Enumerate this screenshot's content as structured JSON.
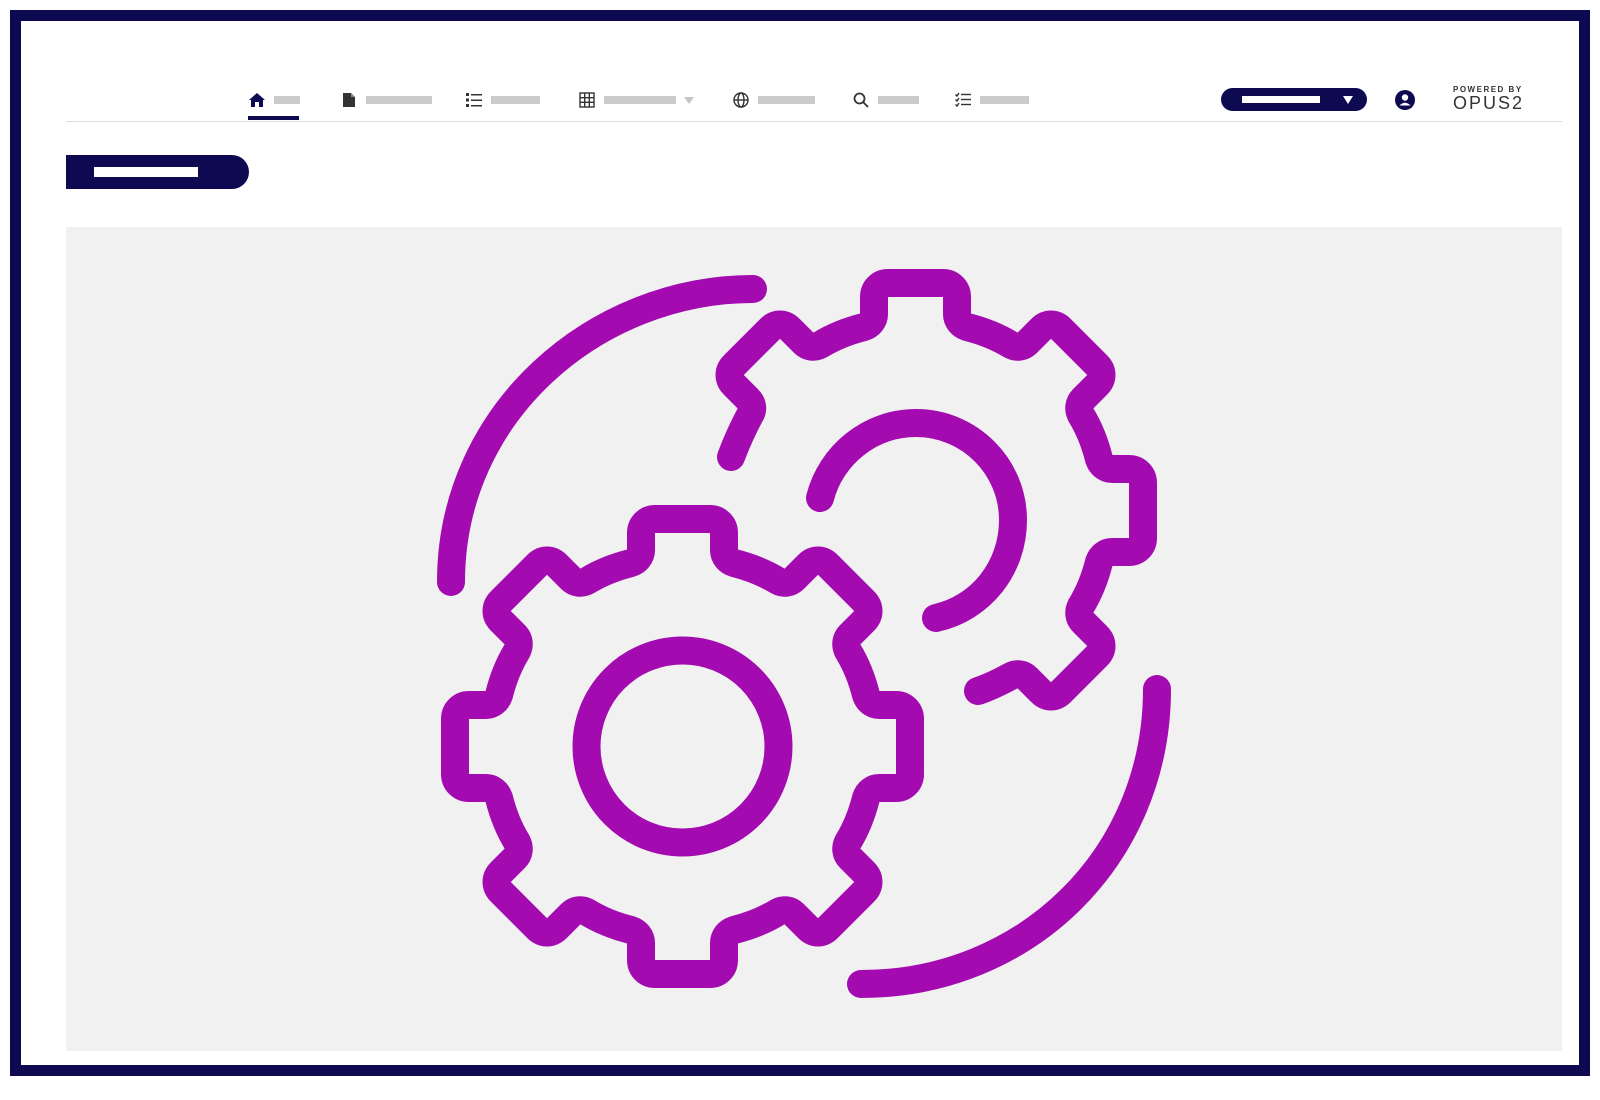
{
  "app": {
    "accent_color": "#0d0a52",
    "illustration_color": "#a30ab0",
    "placeholder_color": "#cbcbcb"
  },
  "nav": {
    "items": [
      {
        "icon": "home-icon",
        "active": true
      },
      {
        "icon": "document-icon",
        "active": false
      },
      {
        "icon": "list-icon",
        "active": false
      },
      {
        "icon": "table-icon",
        "active": false,
        "has_dropdown": true
      },
      {
        "icon": "globe-icon",
        "active": false
      },
      {
        "icon": "search-icon",
        "active": false
      },
      {
        "icon": "checklist-icon",
        "active": false
      }
    ]
  },
  "header": {
    "user_icon": "user-icon",
    "brand_small": "POWERED BY",
    "brand_big": "OPUS2"
  },
  "main": {
    "illustration": "gears-icon"
  }
}
